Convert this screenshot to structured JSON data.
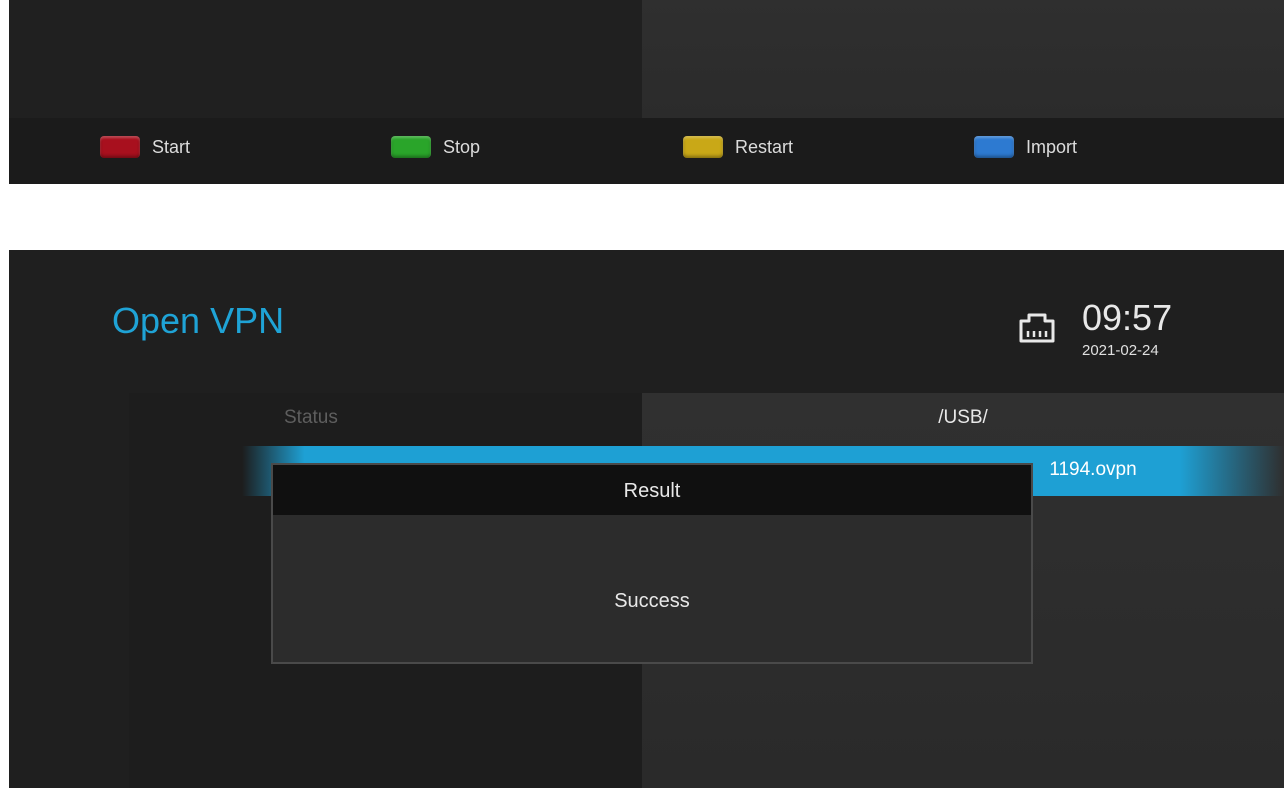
{
  "top_screen": {
    "keys": [
      {
        "label": "Start",
        "color": "#a8101e"
      },
      {
        "label": "Stop",
        "color": "#2aa52a"
      },
      {
        "label": "Restart",
        "color": "#c9a817"
      },
      {
        "label": "Import",
        "color": "#2d7ad1"
      }
    ]
  },
  "header": {
    "title": "Open VPN",
    "network_icon": "ethernet-port-icon",
    "time": "09:57",
    "date": "2021-02-24"
  },
  "settings": {
    "rows": [
      {
        "label": "Status",
        "value": "/USB/"
      },
      {
        "label": "",
        "value": "1194.ovpn"
      }
    ]
  },
  "dialog": {
    "title": "Result",
    "message": "Success"
  },
  "colors": {
    "accent": "#1fa3d6",
    "highlight": "#1ea0d4",
    "background": "#1f1f1f"
  }
}
